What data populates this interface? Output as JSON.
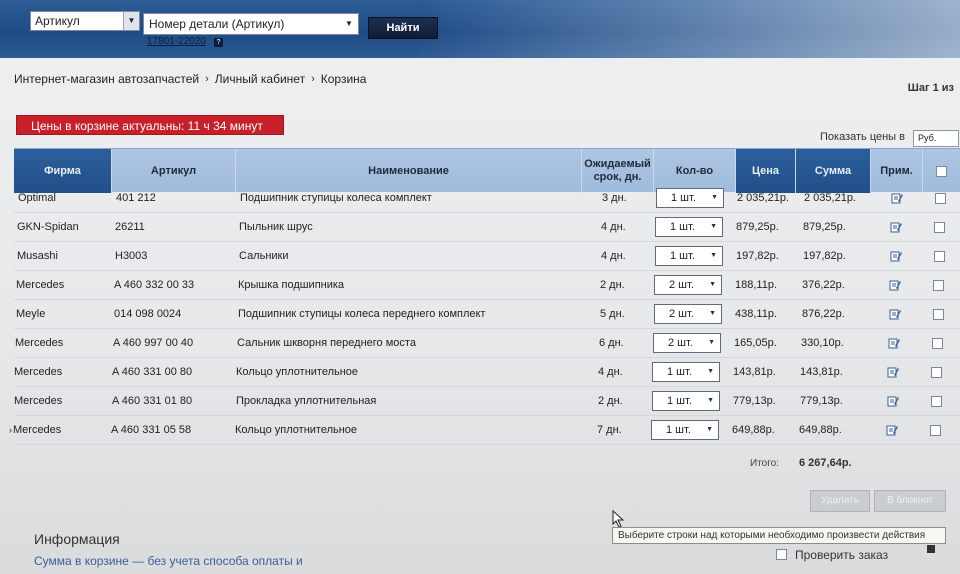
{
  "search": {
    "type_value": "Артикул",
    "field_value": "Номер детали (Артикул)",
    "button_label": "Найти",
    "example_link": "17801-22020",
    "help_mark": "?"
  },
  "breadcrumb": {
    "items": [
      "Интернет-магазин автозапчастей",
      "Личный кабинет",
      "Корзина"
    ],
    "separator": "›"
  },
  "step_label": "Шаг 1 из",
  "timer_text": "Цены в корзине актуальны: 11 ч 34 минут",
  "price_currency": {
    "label": "Показать цены в",
    "value": "Руб."
  },
  "table": {
    "headers": {
      "firm": "Фирма",
      "article": "Артикул",
      "name": "Наименование",
      "term": "Ожидаемый срок, дн.",
      "qty": "Кол-во",
      "price": "Цена",
      "sum": "Сумма",
      "note": "Прим."
    },
    "rows": [
      {
        "firm": "Optimal",
        "article": "401 212",
        "name": "Подшипник ступицы колеса комплект",
        "term": "3 дн.",
        "qty": "1 шт.",
        "price": "2 035,21р.",
        "sum": "2 035,21р."
      },
      {
        "firm": "GKN-Spidan",
        "article": "26211",
        "name": "Пыльник шрус",
        "term": "4 дн.",
        "qty": "1 шт.",
        "price": "879,25р.",
        "sum": "879,25р."
      },
      {
        "firm": "Musashi",
        "article": "H3003",
        "name": "Сальники",
        "term": "4 дн.",
        "qty": "1 шт.",
        "price": "197,82р.",
        "sum": "197,82р."
      },
      {
        "firm": "Mercedes",
        "article": "A 460 332 00 33",
        "name": "Крышка подшипника",
        "term": "2 дн.",
        "qty": "2 шт.",
        "price": "188,11р.",
        "sum": "376,22р."
      },
      {
        "firm": "Meyle",
        "article": "014 098 0024",
        "name": "Подшипник ступицы колеса переднего комплект",
        "term": "5 дн.",
        "qty": "2 шт.",
        "price": "438,11р.",
        "sum": "876,22р."
      },
      {
        "firm": "Mercedes",
        "article": "A 460 997 00 40",
        "name": "Сальник шкворня переднего моста",
        "term": "6 дн.",
        "qty": "2 шт.",
        "price": "165,05р.",
        "sum": "330,10р."
      },
      {
        "firm": "Mercedes",
        "article": "A 460 331 00 80",
        "name": "Кольцо уплотнительное",
        "term": "4 дн.",
        "qty": "1 шт.",
        "price": "143,81р.",
        "sum": "143,81р."
      },
      {
        "firm": "Mercedes",
        "article": "A 460 331 01 80",
        "name": "Прокладка уплотнительная",
        "term": "2 дн.",
        "qty": "1 шт.",
        "price": "779,13р.",
        "sum": "779,13р."
      },
      {
        "firm": "Mercedes",
        "article": "A 460 331 05 58",
        "name": "Кольцо уплотнительное",
        "term": "7 дн.",
        "qty": "1 шт.",
        "price": "649,88р.",
        "sum": "649,88р."
      }
    ],
    "total_label": "Итого:",
    "total_value": "6 267,64р."
  },
  "actions": {
    "delete_label": "Удалить",
    "to_notepad_label": "В блокнот",
    "tooltip": "Выберите строки над которыми необходимо произвести действия",
    "check_order_label": "Проверить заказ"
  },
  "info": {
    "title": "Информация",
    "text": "Сумма в корзине — без учета способа оплаты и"
  },
  "colors": {
    "header_blue": "#2a5a94",
    "timer_red": "#c8202a",
    "table_header": "#aec6e3"
  }
}
